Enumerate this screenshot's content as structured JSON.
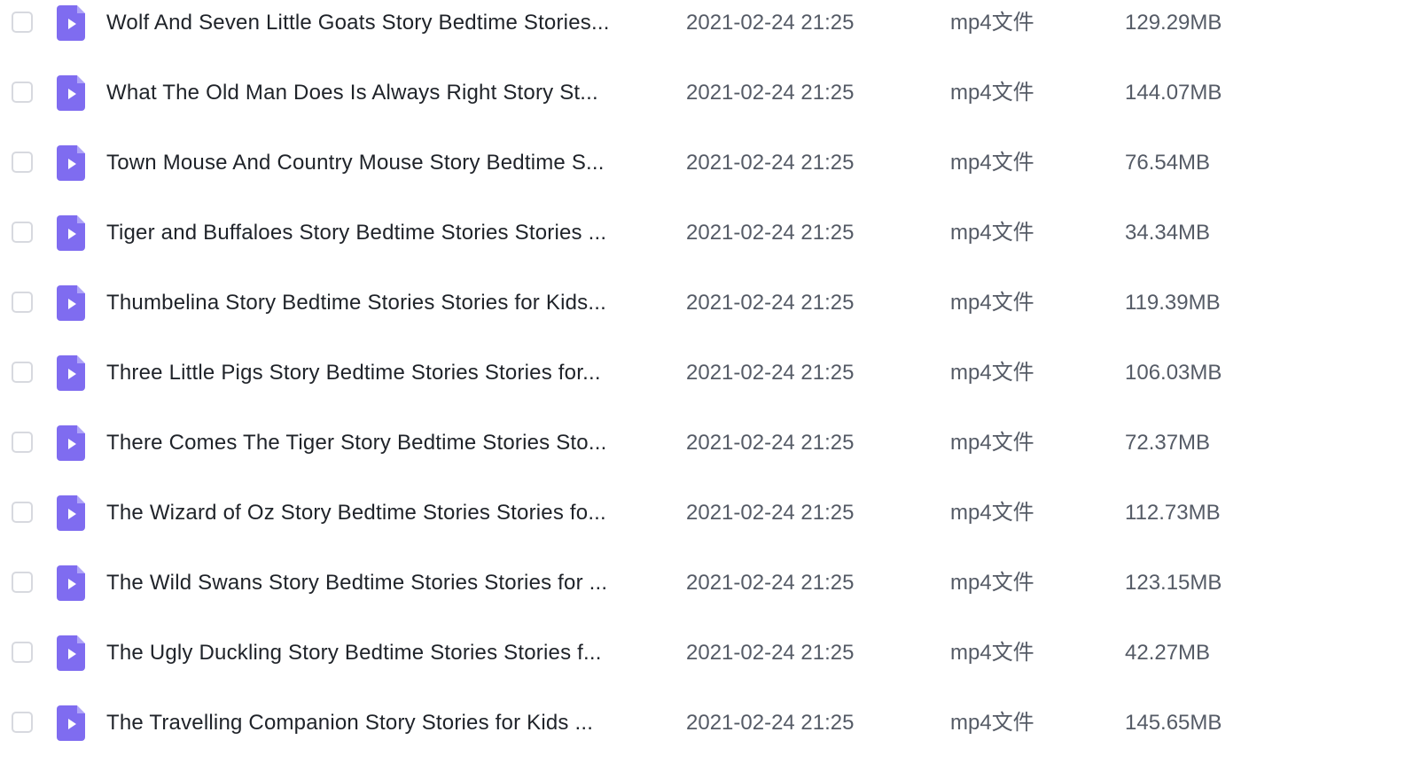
{
  "files": [
    {
      "name": "Wolf And Seven Little Goats Story  Bedtime Stories...",
      "date": "2021-02-24 21:25",
      "type": "mp4文件",
      "size": "129.29MB"
    },
    {
      "name": "What The Old Man Does Is Always Right Story   St...",
      "date": "2021-02-24 21:25",
      "type": "mp4文件",
      "size": "144.07MB"
    },
    {
      "name": "Town Mouse And Country Mouse Story  Bedtime S...",
      "date": "2021-02-24 21:25",
      "type": "mp4文件",
      "size": "76.54MB"
    },
    {
      "name": "Tiger and Buffaloes Story  Bedtime Stories  Stories ...",
      "date": "2021-02-24 21:25",
      "type": "mp4文件",
      "size": "34.34MB"
    },
    {
      "name": "Thumbelina Story  Bedtime Stories  Stories for Kids...",
      "date": "2021-02-24 21:25",
      "type": "mp4文件",
      "size": "119.39MB"
    },
    {
      "name": "Three Little Pigs Story  Bedtime Stories  Stories for...",
      "date": "2021-02-24 21:25",
      "type": "mp4文件",
      "size": "106.03MB"
    },
    {
      "name": "There Comes The Tiger Story  Bedtime Stories  Sto...",
      "date": "2021-02-24 21:25",
      "type": "mp4文件",
      "size": "72.37MB"
    },
    {
      "name": "The Wizard of Oz Story  Bedtime Stories  Stories fo...",
      "date": "2021-02-24 21:25",
      "type": "mp4文件",
      "size": "112.73MB"
    },
    {
      "name": "The Wild Swans Story  Bedtime Stories  Stories for ...",
      "date": "2021-02-24 21:25",
      "type": "mp4文件",
      "size": "123.15MB"
    },
    {
      "name": "The Ugly Duckling Story  Bedtime Stories  Stories f...",
      "date": "2021-02-24 21:25",
      "type": "mp4文件",
      "size": "42.27MB"
    },
    {
      "name": "The Travelling Companion Story  Stories for Kids   ...",
      "date": "2021-02-24 21:25",
      "type": "mp4文件",
      "size": "145.65MB"
    }
  ],
  "icons": {
    "file_icon": "video-file-icon",
    "checkbox": "checkbox"
  },
  "colors": {
    "video_icon": "#7f6cf0",
    "checkbox_border": "#d7d9df"
  }
}
